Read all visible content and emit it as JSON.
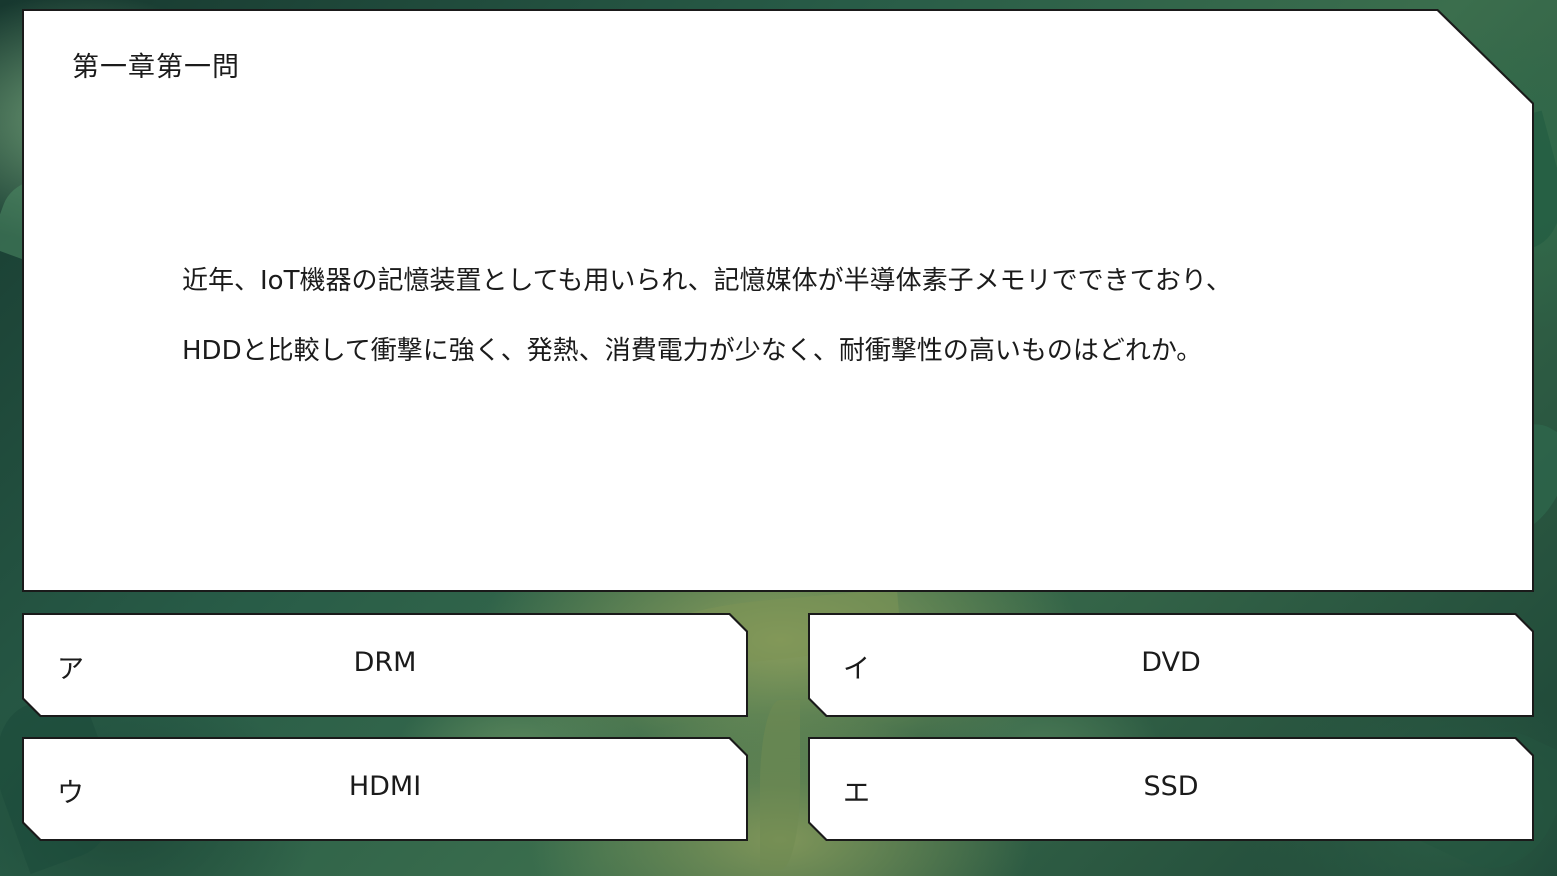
{
  "quiz": {
    "chapter_title": "第一章第一問",
    "question_lines": [
      "近年、IoT機器の記憶装置としても用いられ、記憶媒体が半導体素子メモリでできており、",
      "HDDと比較して衝撃に強く、発熱、消費電力が少なく、耐衝撃性の高いものはどれか。"
    ]
  },
  "answers": [
    {
      "letter": "ア",
      "text": "DRM"
    },
    {
      "letter": "イ",
      "text": "DVD"
    },
    {
      "letter": "ウ",
      "text": "HDMI"
    },
    {
      "letter": "エ",
      "text": "SSD"
    }
  ],
  "colors": {
    "panel_background": "#ffffff",
    "panel_border": "#1a1a1a",
    "background_green_dark": "#17382f",
    "background_green_light": "#8a9d5c"
  }
}
